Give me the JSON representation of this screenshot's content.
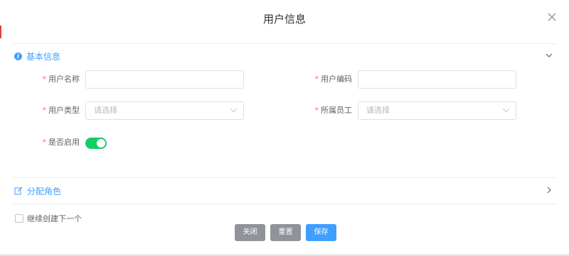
{
  "dialog": {
    "title": "用户信息"
  },
  "sections": {
    "basic": {
      "title": "基本信息",
      "icon": "info-circle-icon",
      "expanded": true
    },
    "roles": {
      "title": "分配角色",
      "icon": "edit-icon",
      "expanded": false
    }
  },
  "form": {
    "username": {
      "label": "用户名称",
      "required": "*",
      "value": ""
    },
    "usercode": {
      "label": "用户编码",
      "required": "*",
      "value": ""
    },
    "usertype": {
      "label": "用户类型",
      "required": "*",
      "placeholder": "请选择"
    },
    "employee": {
      "label": "所属员工",
      "required": "*",
      "placeholder": "请选择"
    },
    "enabled": {
      "label": "是否启用",
      "required": "*",
      "on": true
    }
  },
  "footer": {
    "continue_label": "继续创建下一个",
    "continue_checked": false,
    "close_label": "关闭",
    "reset_label": "重置",
    "save_label": "保存"
  },
  "colors": {
    "accent": "#409eff",
    "switch_on": "#13ce66",
    "required": "#f56c6c",
    "button_gray": "#909399"
  }
}
